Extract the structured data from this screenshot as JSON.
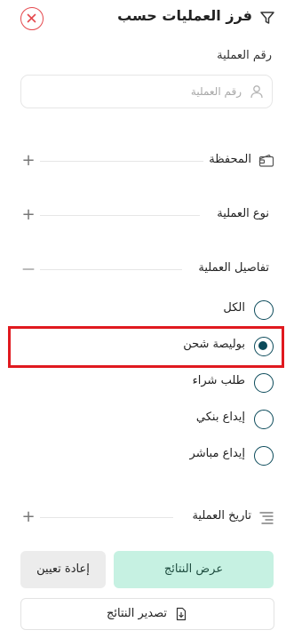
{
  "header": {
    "title": "فرز العمليات حسب"
  },
  "operation_number": {
    "label": "رقم العملية",
    "placeholder": "رقم العملية",
    "value": ""
  },
  "sections": {
    "portfolio": {
      "label": "المحفظة",
      "toggle": "+"
    },
    "operation_type": {
      "label": "نوع العملية",
      "toggle": "+"
    },
    "operation_details": {
      "label": "تفاصيل العملية",
      "toggle": "—"
    },
    "operation_date": {
      "label": "تاريخ العملية",
      "toggle": "+"
    }
  },
  "detail_options": [
    {
      "label": "الكل",
      "selected": false
    },
    {
      "label": "بوليصة شحن",
      "selected": true
    },
    {
      "label": "طلب شراء",
      "selected": false
    },
    {
      "label": "إيداع بنكي",
      "selected": false
    },
    {
      "label": "إيداع مباشر",
      "selected": false
    }
  ],
  "buttons": {
    "show_results": "عرض النتائج",
    "reset": "إعادة تعيين",
    "export_results": "تصدير النتائج"
  },
  "colors": {
    "accent": "#0b4a5a",
    "primary_button_bg": "#c6f1e2",
    "close_red": "#e5484d",
    "highlight_red": "#e0191f"
  }
}
